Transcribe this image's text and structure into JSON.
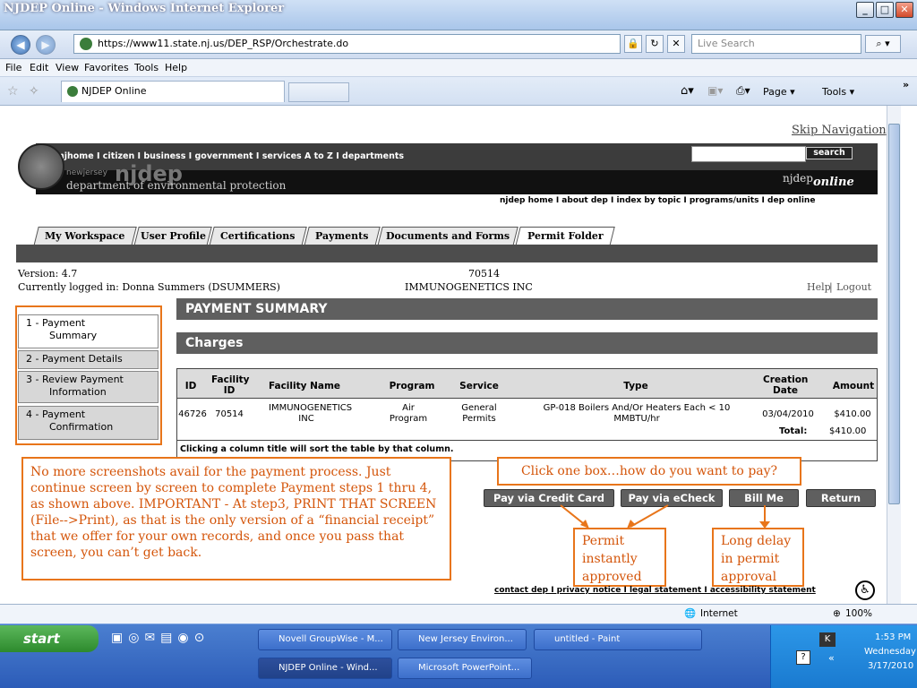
{
  "window": {
    "title": "NJDEP Online - Windows Internet Explorer",
    "minimize": "_",
    "maximize": "□",
    "close": "✕"
  },
  "nav": {
    "url": "https://www11.state.nj.us/DEP_RSP/Orchestrate.do",
    "search_placeholder": "Live Search"
  },
  "menu": [
    "File",
    "Edit",
    "View",
    "Favorites",
    "Tools",
    "Help"
  ],
  "ie_tab": {
    "label": "NJDEP Online"
  },
  "toolbar": {
    "page": "Page ▾",
    "tools": "Tools ▾"
  },
  "site": {
    "skip_nav": "Skip Navigation",
    "topnav": "njhome  I  citizen  I  business  I  government  I  services A to Z  I  departments",
    "search_button": "search",
    "logo_small": "newjersey",
    "logo_big": "njdep",
    "logo_sub": "department of environmental protection",
    "njdep_online_a": "njdep",
    "njdep_online_b": "online",
    "subnav": "njdep home  I  about dep  I  index by topic  I  programs/units  I  dep online",
    "footer": "contact dep  I  privacy notice  I  legal statement  I  accessibility statement"
  },
  "tabs": [
    "My Workspace",
    "User Profile",
    "Certifications",
    "Payments",
    "Documents and Forms",
    "Permit Folder"
  ],
  "info": {
    "version": "Version: 4.7",
    "logged_in": "Currently logged in: Donna Summers (DSUMMERS)",
    "facility_id": "70514",
    "facility_name": "IMMUNOGENETICS INC",
    "help": "Help",
    "sep": "|",
    "logout": "Logout"
  },
  "steps": [
    {
      "l1": "1 - Payment",
      "l2": "Summary"
    },
    {
      "l1": "2 - Payment Details",
      "l2": ""
    },
    {
      "l1": "3 - Review Payment",
      "l2": "Information"
    },
    {
      "l1": "4 - Payment",
      "l2": "Confirmation"
    }
  ],
  "summary": {
    "heading": "PAYMENT SUMMARY",
    "charges": "Charges"
  },
  "table": {
    "headers": [
      "ID",
      "Facility ID",
      "Facility Name",
      "Program",
      "Service",
      "Type",
      "Creation Date",
      "Amount"
    ],
    "row": {
      "id": "46726",
      "facility_id": "70514",
      "facility_name": "IMMUNOGENETICS INC",
      "program": "Air Program",
      "service": "General Permits",
      "type": "GP-018 Boilers And/Or Heaters Each < 10 MMBTU/hr",
      "date": "03/04/2010",
      "amount": "$410.00"
    },
    "total_label": "Total:",
    "total_value": "$410.00",
    "note": "Clicking a column title will sort the table by that column."
  },
  "buttons": {
    "credit": "Pay via Credit Card",
    "echeck": "Pay via eCheck",
    "bill": "Bill Me",
    "return": "Return"
  },
  "annotations": {
    "main": "No more screenshots avail for the payment process.  Just continue screen by screen to complete Payment steps 1 thru 4, as shown above.  IMPORTANT - At  step3, PRINT THAT SCREEN (File-->Print), as that is the only version of a “financial receipt” that we offer for your own records, and once you pass that screen, you can’t get back.",
    "choose": "Click one box…how do you want to pay?",
    "instant": "Permit instantly approved",
    "delay": "Long delay in permit approval"
  },
  "status": {
    "zone": "Internet",
    "zoom": "100%"
  },
  "taskbar": {
    "start": "start",
    "tasks": [
      "Novell GroupWise - M...",
      "New Jersey Environ...",
      "untitled - Paint",
      "NJDEP Online - Wind...",
      "Microsoft PowerPoint..."
    ],
    "time": "1:53 PM",
    "day": "Wednesday",
    "date": "3/17/2010"
  }
}
